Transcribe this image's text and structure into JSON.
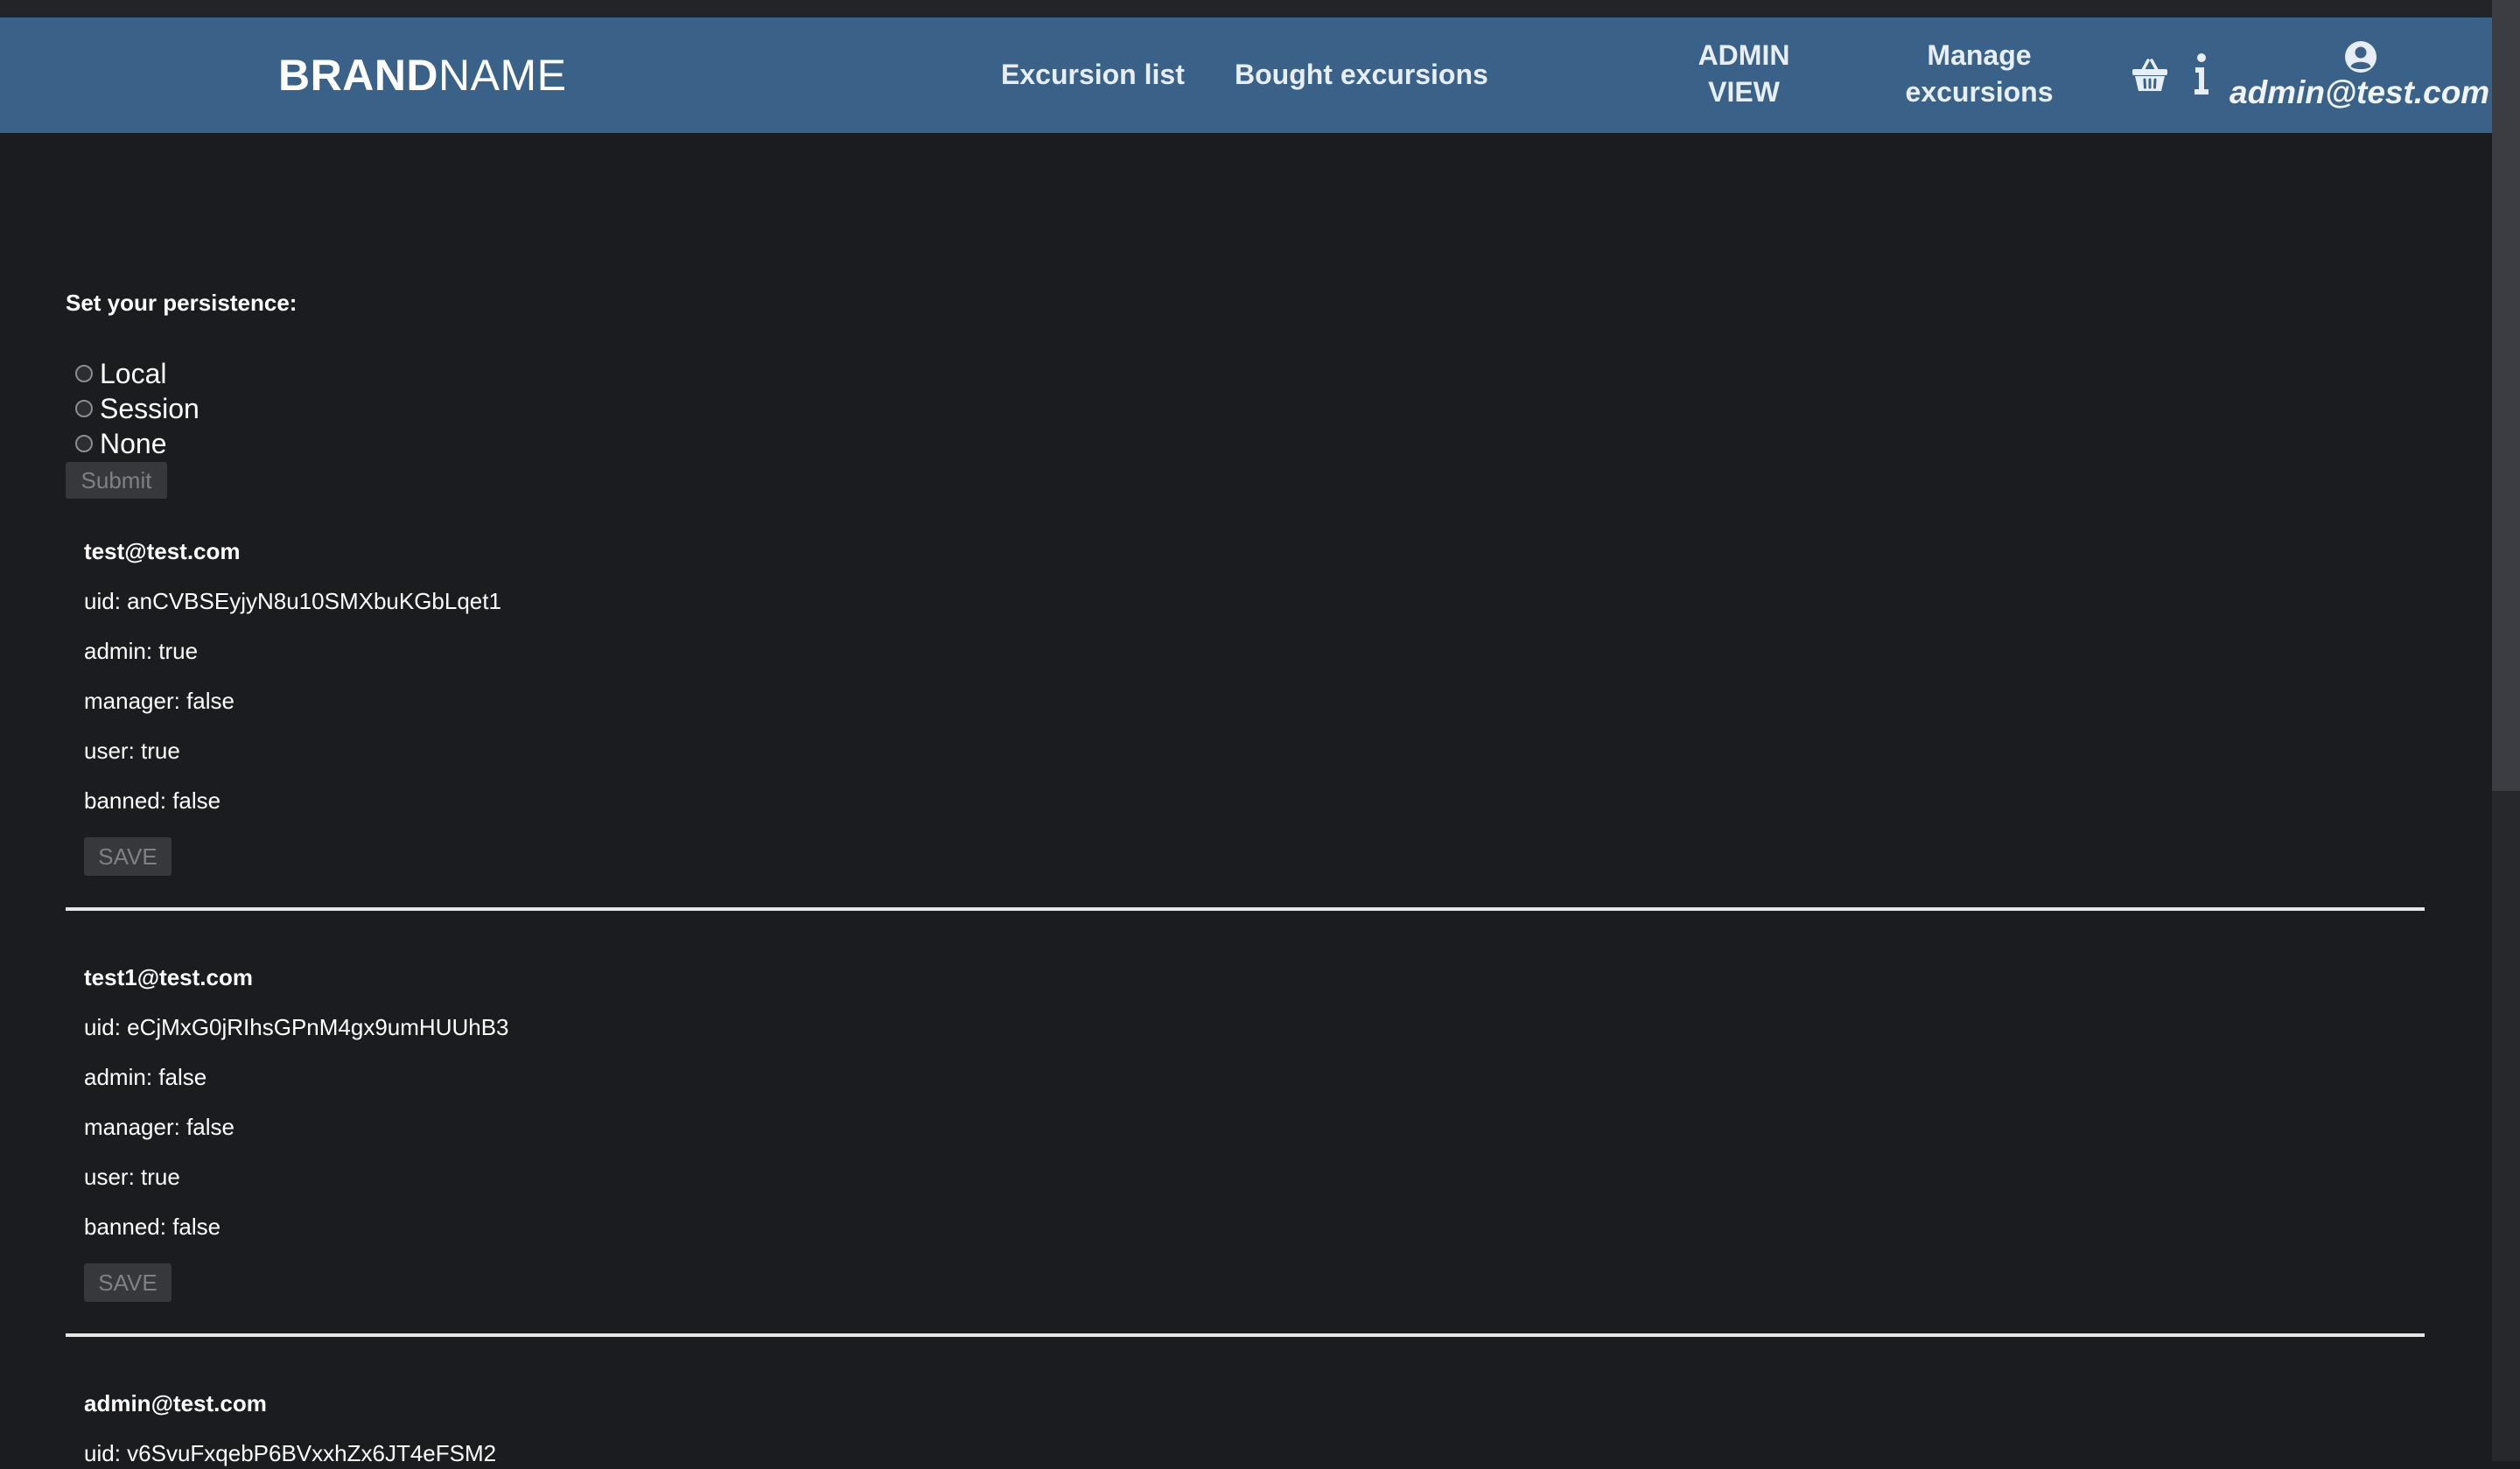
{
  "nav": {
    "brand_bold": "BRAND",
    "brand_light": "NAME",
    "links": {
      "excursion_list": "Excursion list",
      "bought_excursions": "Bought excursions",
      "admin_view_line1": "ADMIN",
      "admin_view_line2": "VIEW",
      "manage_line1": "Manage",
      "manage_line2": "excursions"
    },
    "icons": {
      "cart": "basket-icon",
      "info": "info-icon",
      "user": "user-circle-icon"
    },
    "user_email": "admin@test.com",
    "colors": {
      "navbar": "#3a6288",
      "background": "#1a1c1f"
    }
  },
  "persistence": {
    "title": "Set your persistence:",
    "options": [
      "Local",
      "Session",
      "None"
    ],
    "submit_label": "Submit"
  },
  "users": [
    {
      "email": "test@test.com",
      "uid": "uid: anCVBSEyjyN8u10SMXbuKGbLqet1",
      "admin": "admin: true",
      "manager": "manager: false",
      "user": "user: true",
      "banned": "banned: false",
      "save_label": "SAVE"
    },
    {
      "email": "test1@test.com",
      "uid": "uid: eCjMxG0jRIhsGPnM4gx9umHUUhB3",
      "admin": "admin: false",
      "manager": "manager: false",
      "user": "user: true",
      "banned": "banned: false",
      "save_label": "SAVE"
    },
    {
      "email": "admin@test.com",
      "uid": "uid: v6SvuFxqebP6BVxxhZx6JT4eFSM2"
    }
  ]
}
